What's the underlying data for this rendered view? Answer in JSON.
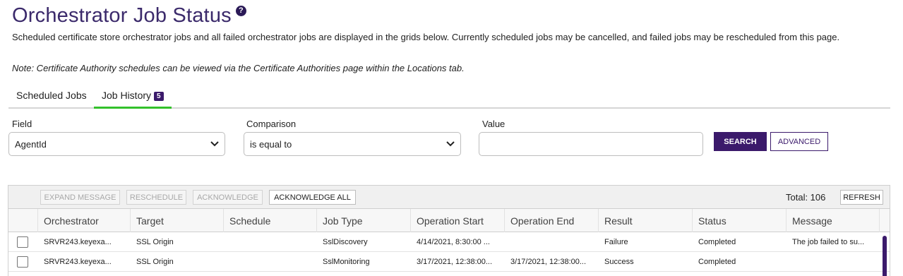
{
  "page": {
    "title": "Orchestrator Job Status",
    "help_icon": "question-circle-icon",
    "description": "Scheduled certificate store orchestrator jobs and all failed orchestrator jobs are displayed in the grids below. Currently scheduled jobs may be cancelled, and failed jobs may be rescheduled from this page.",
    "note": "Note: Certificate Authority schedules can be viewed via the Certificate Authorities page within the Locations tab."
  },
  "tabs": {
    "scheduled": "Scheduled Jobs",
    "history": "Job History",
    "history_count": "5",
    "active": "Job History"
  },
  "filter": {
    "field_label": "Field",
    "field_value": "AgentId",
    "comparison_label": "Comparison",
    "comparison_value": "is equal to",
    "value_label": "Value",
    "value": "",
    "search_label": "SEARCH",
    "advanced_label": "ADVANCED"
  },
  "toolbar": {
    "expand_message": "EXPAND MESSAGE",
    "reschedule": "RESCHEDULE",
    "acknowledge": "ACKNOWLEDGE",
    "acknowledge_all": "ACKNOWLEDGE ALL",
    "total": "Total: 106",
    "refresh": "REFRESH"
  },
  "grid": {
    "columns": [
      "Orchestrator",
      "Target",
      "Schedule",
      "Job Type",
      "Operation Start",
      "Operation End",
      "Result",
      "Status",
      "Message"
    ],
    "rows": [
      [
        "SRVR243.keyexa...",
        "SSL Origin",
        "",
        "SslDiscovery",
        "4/14/2021, 8:30:00 ...",
        "",
        "Failure",
        "Completed",
        "The job failed to su..."
      ],
      [
        "SRVR243.keyexa...",
        "SSL Origin",
        "",
        "SslMonitoring",
        "3/17/2021, 12:38:00...",
        "3/17/2021, 12:38:00...",
        "Success",
        "Completed",
        ""
      ]
    ]
  },
  "colors": {
    "brand_purple": "#3b1a6b",
    "tab_active_underline": "#33c12b",
    "title_color": "#3b2a6b"
  }
}
